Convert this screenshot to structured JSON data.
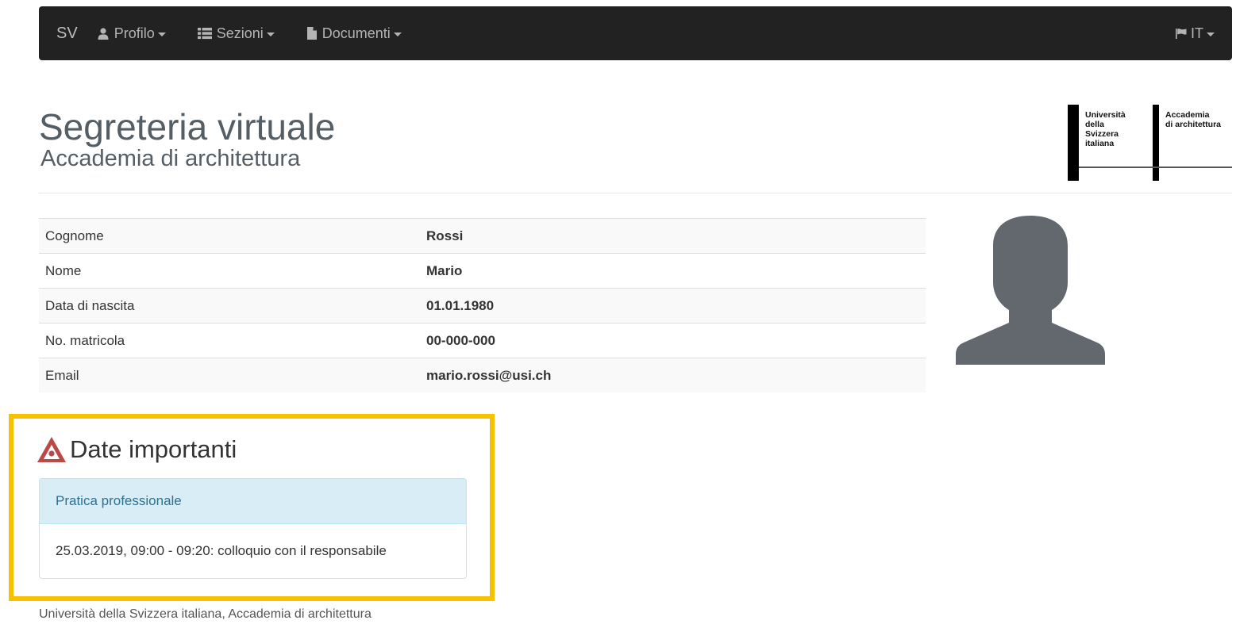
{
  "navbar": {
    "brand": "SV",
    "items": [
      {
        "label": "Profilo",
        "icon": "user-icon"
      },
      {
        "label": "Sezioni",
        "icon": "list-icon"
      },
      {
        "label": "Documenti",
        "icon": "document-icon"
      }
    ],
    "language": {
      "label": "IT",
      "icon": "flag-icon"
    }
  },
  "header": {
    "title": "Segreteria virtuale",
    "subtitle": "Accademia di architettura",
    "logo": {
      "left_lines": [
        "Università",
        "della",
        "Svizzera",
        "italiana"
      ],
      "right_lines": [
        "Accademia",
        "di architettura"
      ]
    }
  },
  "profile": {
    "rows": [
      {
        "label": "Cognome",
        "value": "Rossi"
      },
      {
        "label": "Nome",
        "value": "Mario"
      },
      {
        "label": "Data di nascita",
        "value": "01.01.1980"
      },
      {
        "label": "No. matricola",
        "value": "00-000-000"
      },
      {
        "label": "Email",
        "value": "mario.rossi@usi.ch"
      }
    ],
    "avatar_icon": "user-silhouette-icon"
  },
  "important_dates": {
    "title": "Date importanti",
    "icon": "warning-icon",
    "panel": {
      "heading": "Pratica professionale",
      "body": "25.03.2019, 09:00 - 09:20: colloquio con il responsabile"
    }
  },
  "footer": {
    "text": "Università della Svizzera italiana, Accademia di architettura"
  },
  "colors": {
    "navbar_bg": "#222222",
    "highlight_border": "#f5c100",
    "panel_heading_bg": "#d9edf7",
    "panel_heading_text": "#31708f",
    "warning_icon": "#b94a48"
  }
}
